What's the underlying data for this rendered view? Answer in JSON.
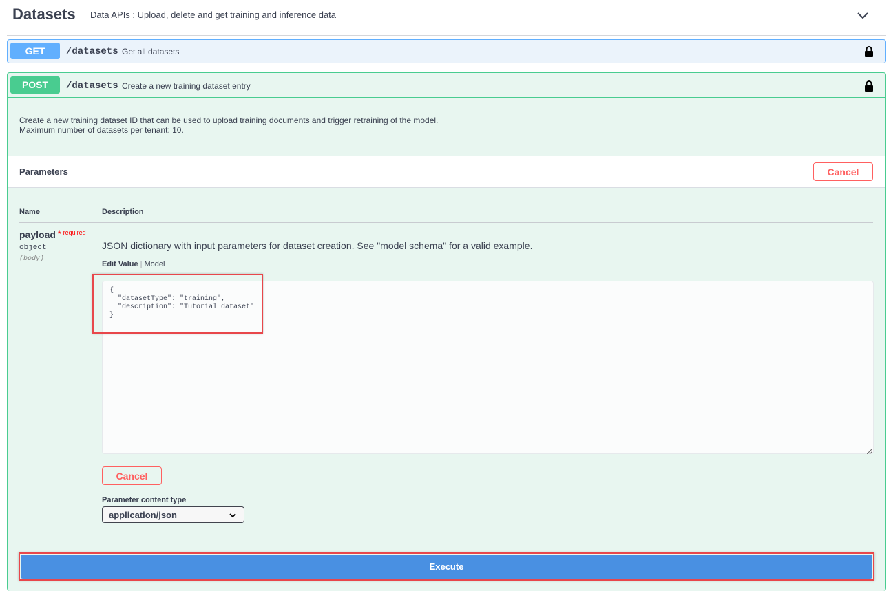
{
  "tag": {
    "title": "Datasets",
    "description": "Data APIs : Upload, delete and get training and inference data",
    "expand_icon": "chevron-down-icon"
  },
  "operations": {
    "get": {
      "method": "GET",
      "path": "/datasets",
      "summary": "Get all datasets",
      "color": "#61affe",
      "lock_icon": "lock-icon"
    },
    "post": {
      "method": "POST",
      "path": "/datasets",
      "summary": "Create a new training dataset entry",
      "color": "#49cc90",
      "lock_icon": "lock-icon",
      "description_line1": "Create a new training dataset ID that can be used to upload training documents and trigger retraining of the model.",
      "description_line2": "Maximum number of datasets per tenant: 10."
    }
  },
  "parameters": {
    "title": "Parameters",
    "cancel_label": "Cancel",
    "col_name": "Name",
    "col_description": "Description",
    "param": {
      "name": "payload",
      "required_star": "*",
      "required_label": "required",
      "type": "object",
      "in": "(body)",
      "description": "JSON dictionary with input parameters for dataset creation. See \"model schema\" for a valid example.",
      "tab_edit": "Edit Value",
      "tab_model": "Model",
      "body_value": "{\n  \"datasetType\": \"training\",\n  \"description\": \"Tutorial dataset\"\n}"
    },
    "cancel_label_2": "Cancel",
    "content_type_label": "Parameter content type",
    "content_type_value": "application/json"
  },
  "execute_label": "Execute",
  "colors": {
    "cancel": "#ff6060",
    "execute": "#4990e2",
    "highlight": "#e8474b"
  }
}
